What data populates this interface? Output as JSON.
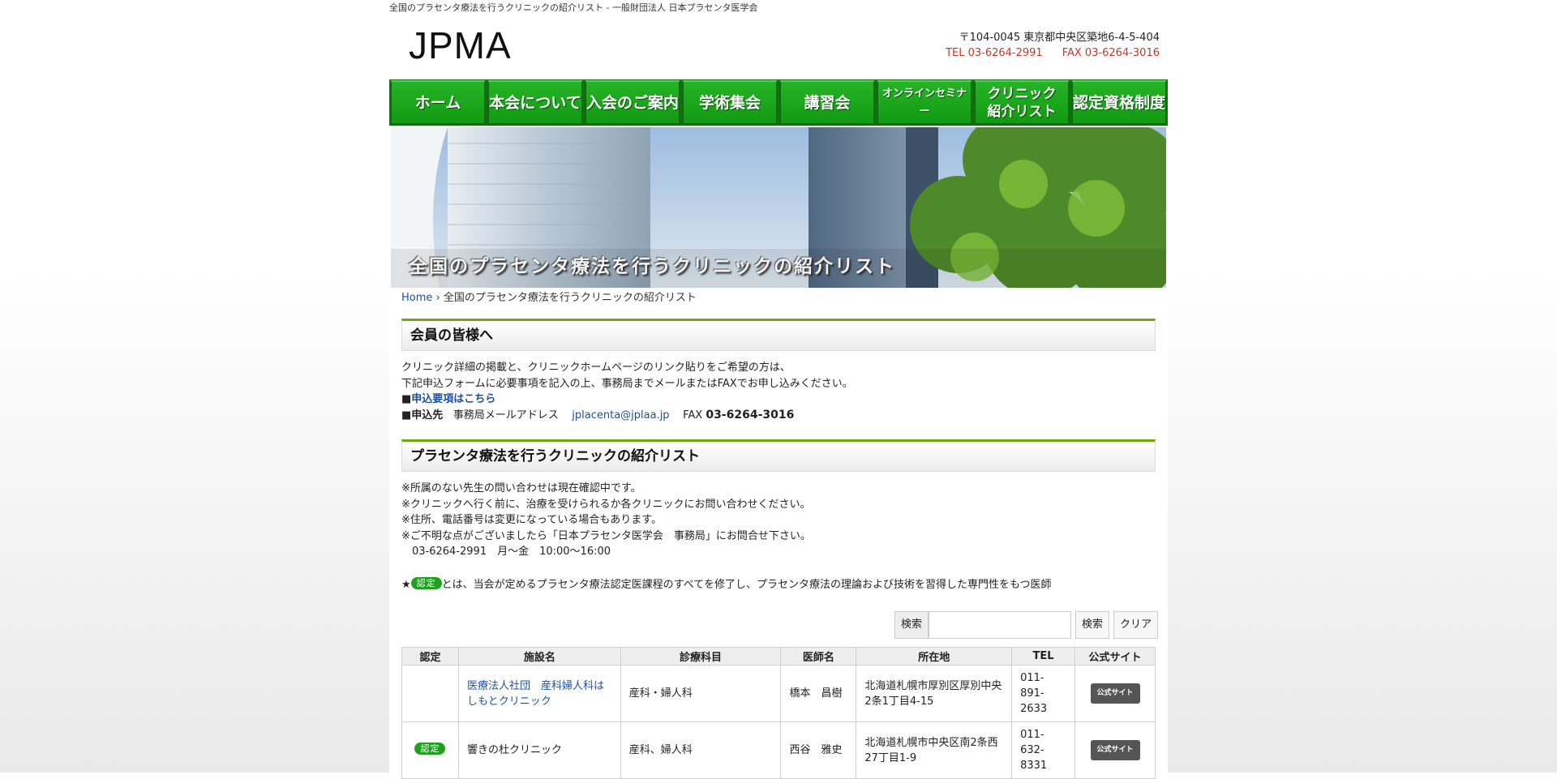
{
  "tagline": "全国のプラセンタ療法を行うクリニックの紹介リスト - 一般財団法人 日本プラセンタ医学会",
  "logo": "JPMA",
  "contact": {
    "address": "〒104-0045 東京都中央区築地6-4-5-404",
    "tel": "TEL 03-6264-2991",
    "fax": "FAX 03-6264-3016"
  },
  "nav": [
    {
      "label": "ホーム"
    },
    {
      "label": "本会について"
    },
    {
      "label": "入会のご案内"
    },
    {
      "label": "学術集会"
    },
    {
      "label": "講習会"
    },
    {
      "label": "オンラインセミナー"
    },
    {
      "label": "クリニック\n紹介リスト"
    },
    {
      "label": "認定資格制度"
    }
  ],
  "hero_caption": "全国のプラセンタ療法を行うクリニックの紹介リスト",
  "breadcrumb": {
    "home": "Home",
    "separator": " › ",
    "current": "全国のプラセンタ療法を行うクリニックの紹介リスト"
  },
  "members": {
    "heading": "会員の皆様へ",
    "line1": "クリニック詳細の掲載と、クリニックホームページのリンク貼りをご希望の方は、",
    "line2": "下記申込フォームに必要事項を記入の上、事務局までメールまたはFAXでお申し込みください。",
    "bullet": "■",
    "link_label": "申込要項はこちら",
    "apply_label": "申込先",
    "mail_label": "事務局メールアドレス",
    "email": "jplacenta@jplaa.jp",
    "fax_label": "FAX",
    "fax_number": "03-6264-3016"
  },
  "list_section": {
    "heading": "プラセンタ療法を行うクリニックの紹介リスト",
    "notes": [
      "※所属のない先生の問い合わせは現在確認中です。",
      "※クリニックへ行く前に、治療を受けられるか各クリニックにお問い合わせください。",
      "※住所、電話番号は変更になっている場合もあります。",
      "※ご不明な点がございましたら「日本プラセンタ医学会　事務局」にお問合せ下さい。",
      "　03-6264-2991　月～金　10:00～16:00"
    ],
    "star": "★",
    "badge": "認定",
    "badge_desc": "とは、当会が定めるプラセンタ療法認定医課程のすべてを修了し、プラセンタ療法の理論および技術を習得した専門性をもつ医師"
  },
  "search": {
    "label": "検索",
    "button": "検索",
    "clear": "クリア",
    "value": ""
  },
  "table": {
    "headers": [
      "認定",
      "施設名",
      "診療科目",
      "医師名",
      "所在地",
      "TEL",
      "公式サイト"
    ],
    "rows": [
      {
        "certified": "",
        "name": "医療法人社団　産科婦人科はしもとクリニック",
        "dept": "産科・婦人科",
        "doctor": "橋本　昌樹",
        "address": "北海道札幌市厚別区厚別中央2条1丁目4-15",
        "tel": "011-891-2633",
        "site": "公式サイト"
      },
      {
        "certified": "認定",
        "name": "響きの杜クリニック",
        "dept": "産科、婦人科",
        "doctor": "西谷　雅史",
        "address": "北海道札幌市中央区南2条西27丁目1-9",
        "tel": "011-632-8331",
        "site": "公式サイト"
      }
    ]
  }
}
